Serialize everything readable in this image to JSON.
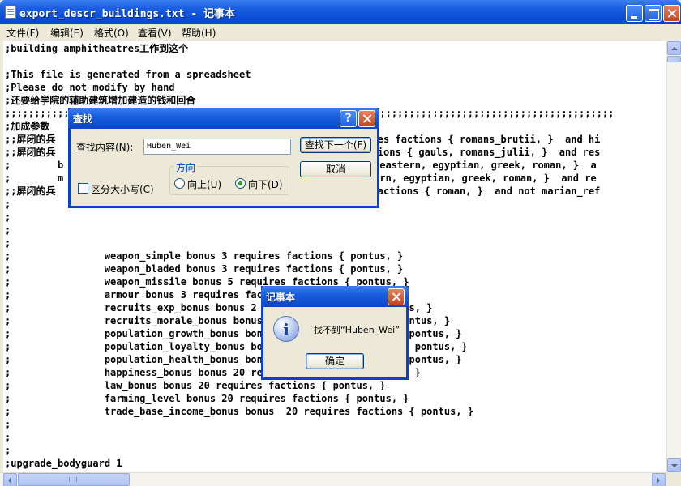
{
  "window": {
    "title": "export_descr_buildings.txt - 记事本",
    "minimize_icon": "minimize-icon",
    "maximize_icon": "maximize-icon",
    "close_icon": "close-icon"
  },
  "menu": [
    {
      "label": "文件(F)"
    },
    {
      "label": "编辑(E)"
    },
    {
      "label": "格式(O)"
    },
    {
      "label": "查看(V)"
    },
    {
      "label": "帮助(H)"
    }
  ],
  "editor": {
    "lines": [
      ";building amphitheatres工作到这个",
      "",
      ";This file is generated from a spreadsheet",
      ";Please do not modify by hand",
      ";还要给学院的辅助建筑增加建造的钱和回合",
      ";;;;;;;;;;;;;;;;;;;;;;;;;;;;;;;;;;;;;;;;;;;;;;;;;;;;;;;;;;;;;;;;;;;;;;;;;;;;;;;;;;;;;;;;;;;;;;;;;;;;;;;;",
      ";加成参数",
      ";;屏闭的兵                                                 requires factions { romans_brutii, }  and hi",
      ";;屏闭的兵                                                 s factions { gauls, romans_julii, }  and res",
      ";        b                                               inian, eastern, egyptian, greek, roman, }  a",
      ";        m                                               , eastern, egyptian, greek, roman, }  and re",
      ";;屏闭的兵                                                 ires factions { roman, }  and not marian_ref",
      ";",
      ";",
      ";",
      ";",
      ";                weapon_simple bonus 3 requires factions { pontus, }",
      ";                weapon_bladed bonus 3 requires factions { pontus, }",
      ";                weapon_missile bonus 5 requires factions { pontus, }",
      ";                armour bonus 3 requires factions { pontus, }",
      ";                recruits_exp_bonus bonus 2 requires factions { pontus, }",
      ";                recruits_morale_bonus bonus 2 requires factions { pontus, }",
      ";                population_growth_bonus bonus 2 requires factions { pontus, }",
      ";                population_loyalty_bonus bonus 2 requires factions { pontus, }",
      ";                population_health_bonus bonus 2 requires factions { pontus, }",
      ";                happiness_bonus bonus 20 requires factions { pontus, }",
      ";                law_bonus bonus 20 requires factions { pontus, }",
      ";                farming_level bonus 20 requires factions { pontus, }",
      ";                trade_base_income_bonus bonus  20 requires factions { pontus, }",
      ";",
      ";",
      ";",
      ";upgrade_bodyguard 1"
    ]
  },
  "find_dialog": {
    "title": "查找",
    "help_label": "?",
    "find_what_label": "查找内容(N):",
    "find_what_value": "Huben_Wei",
    "find_next_label": "查找下一个(F)",
    "cancel_label": "取消",
    "match_case_label": "区分大小写(C)",
    "match_case_checked": false,
    "direction_label": "方向",
    "up_label": "向上(U)",
    "down_label": "向下(D)",
    "direction_selected": "down"
  },
  "message_box": {
    "title": "记事本",
    "icon": "info-icon",
    "icon_glyph": "i",
    "message": "找不到“Huben_Wei”",
    "ok_label": "确定"
  }
}
